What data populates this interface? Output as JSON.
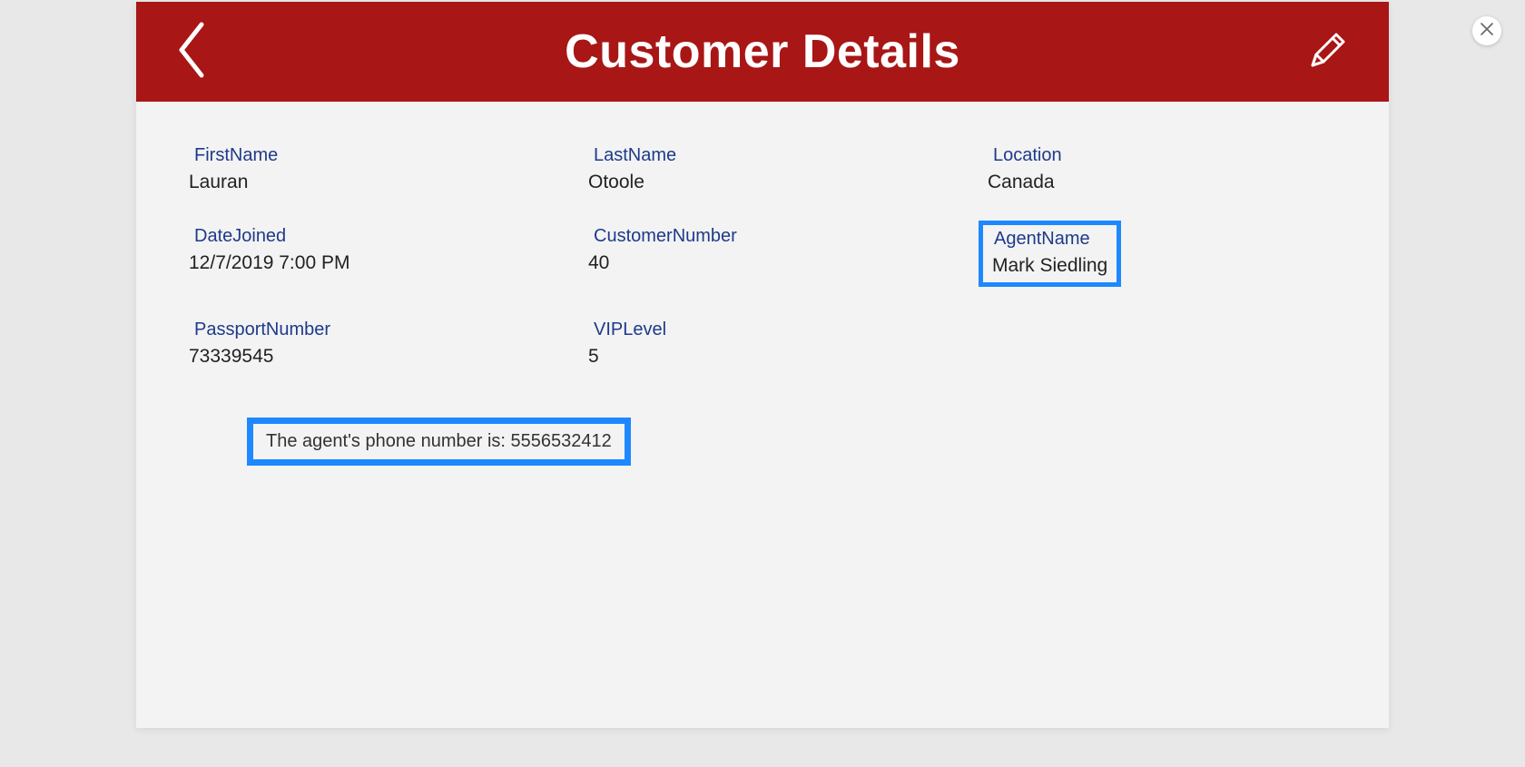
{
  "header": {
    "title": "Customer Details"
  },
  "fields": {
    "firstName": {
      "label": "FirstName",
      "value": "Lauran"
    },
    "lastName": {
      "label": "LastName",
      "value": "Otoole"
    },
    "location": {
      "label": "Location",
      "value": "Canada"
    },
    "dateJoined": {
      "label": "DateJoined",
      "value": "12/7/2019 7:00 PM"
    },
    "customerNumber": {
      "label": "CustomerNumber",
      "value": "40"
    },
    "agentName": {
      "label": "AgentName",
      "value": "Mark Siedling"
    },
    "passportNumber": {
      "label": "PassportNumber",
      "value": "73339545"
    },
    "vipLevel": {
      "label": "VIPLevel",
      "value": "5"
    }
  },
  "agentPhone": {
    "prefix": "The agent's phone number is: ",
    "value": "5556532412"
  },
  "colors": {
    "headerBg": "#a81616",
    "labelColor": "#1e3a8a",
    "highlight": "#1e88ff"
  }
}
